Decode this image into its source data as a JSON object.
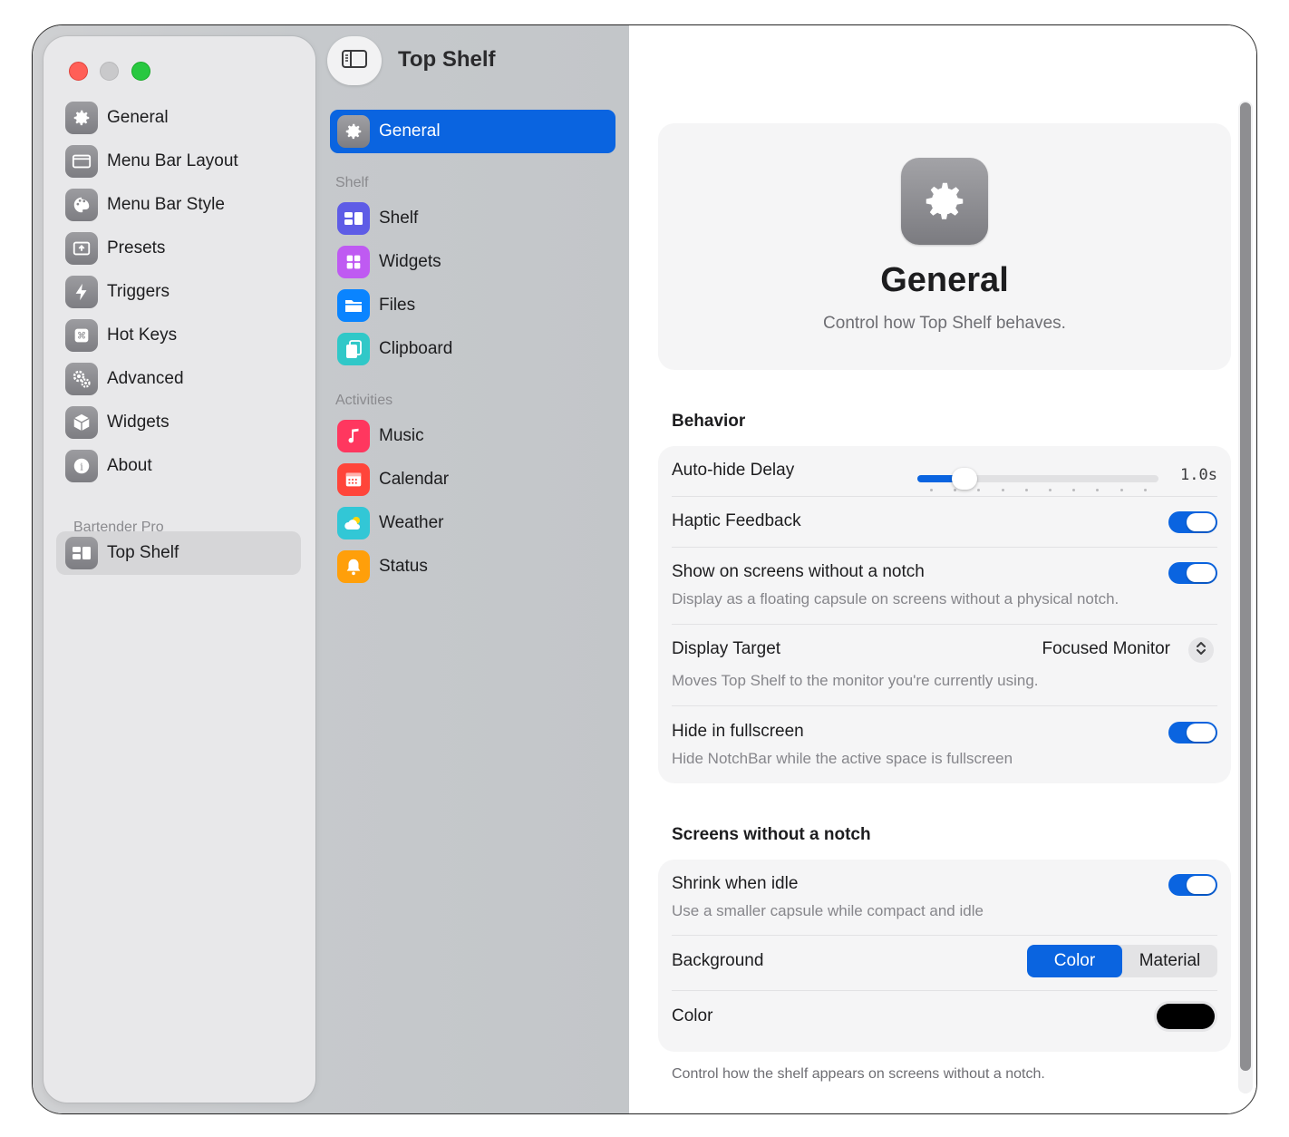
{
  "window": {
    "title": "Top Shelf"
  },
  "sidebar": {
    "items": [
      {
        "label": "General",
        "icon": "gear-icon"
      },
      {
        "label": "Menu Bar Layout",
        "icon": "menubar-icon"
      },
      {
        "label": "Menu Bar Style",
        "icon": "palette-icon"
      },
      {
        "label": "Presets",
        "icon": "presets-icon"
      },
      {
        "label": "Triggers",
        "icon": "bolt-icon"
      },
      {
        "label": "Hot Keys",
        "icon": "command-icon"
      },
      {
        "label": "Advanced",
        "icon": "gears-icon"
      },
      {
        "label": "Widgets",
        "icon": "cube-icon"
      },
      {
        "label": "About",
        "icon": "info-icon"
      }
    ],
    "section_label": "Bartender Pro",
    "pro_items": [
      {
        "label": "Top Shelf",
        "icon": "top-shelf-icon",
        "selected": true
      }
    ]
  },
  "subnav": {
    "general": {
      "label": "General",
      "icon": "gear-icon",
      "selected": true
    },
    "sections": [
      {
        "title": "Shelf",
        "items": [
          {
            "label": "Shelf",
            "icon": "shelf-icon",
            "color": "#5e5ce6"
          },
          {
            "label": "Widgets",
            "icon": "grid-icon",
            "color": "#bf5af2"
          },
          {
            "label": "Files",
            "icon": "folder-icon",
            "color": "#0a84ff"
          },
          {
            "label": "Clipboard",
            "icon": "clipboard-icon",
            "color": "#30c8c8"
          }
        ]
      },
      {
        "title": "Activities",
        "items": [
          {
            "label": "Music",
            "icon": "music-note-icon",
            "color": "#ff375f"
          },
          {
            "label": "Calendar",
            "icon": "calendar-icon",
            "color": "#ff453a"
          },
          {
            "label": "Weather",
            "icon": "weather-icon",
            "color": "#32c7d6"
          },
          {
            "label": "Status",
            "icon": "bell-icon",
            "color": "#ff9f0a"
          }
        ]
      }
    ]
  },
  "header": {
    "title": "General",
    "subtitle": "Control how Top Shelf behaves.",
    "icon": "gear-icon"
  },
  "behavior": {
    "title": "Behavior",
    "auto_hide": {
      "label": "Auto-hide Delay",
      "value": "1.0s",
      "fraction": 0.1
    },
    "haptic": {
      "label": "Haptic Feedback",
      "on": true
    },
    "no_notch": {
      "label": "Show on screens without a notch",
      "description": "Display as a floating capsule on screens without a physical notch.",
      "on": true
    },
    "display_target": {
      "label": "Display Target",
      "value": "Focused Monitor",
      "description": "Moves Top Shelf to the monitor you're currently using."
    },
    "hide_fullscreen": {
      "label": "Hide in fullscreen",
      "description": "Hide NotchBar while the active space is fullscreen",
      "on": true
    }
  },
  "screens": {
    "title": "Screens without a notch",
    "shrink": {
      "label": "Shrink when idle",
      "description": "Use a smaller capsule while compact and idle",
      "on": true
    },
    "background": {
      "label": "Background",
      "options": [
        "Color",
        "Material"
      ],
      "selected": "Color"
    },
    "color": {
      "label": "Color",
      "value": "#000000"
    },
    "footnote": "Control how the shelf appears on screens without a notch."
  },
  "colors": {
    "accent": "#0a64e0"
  }
}
